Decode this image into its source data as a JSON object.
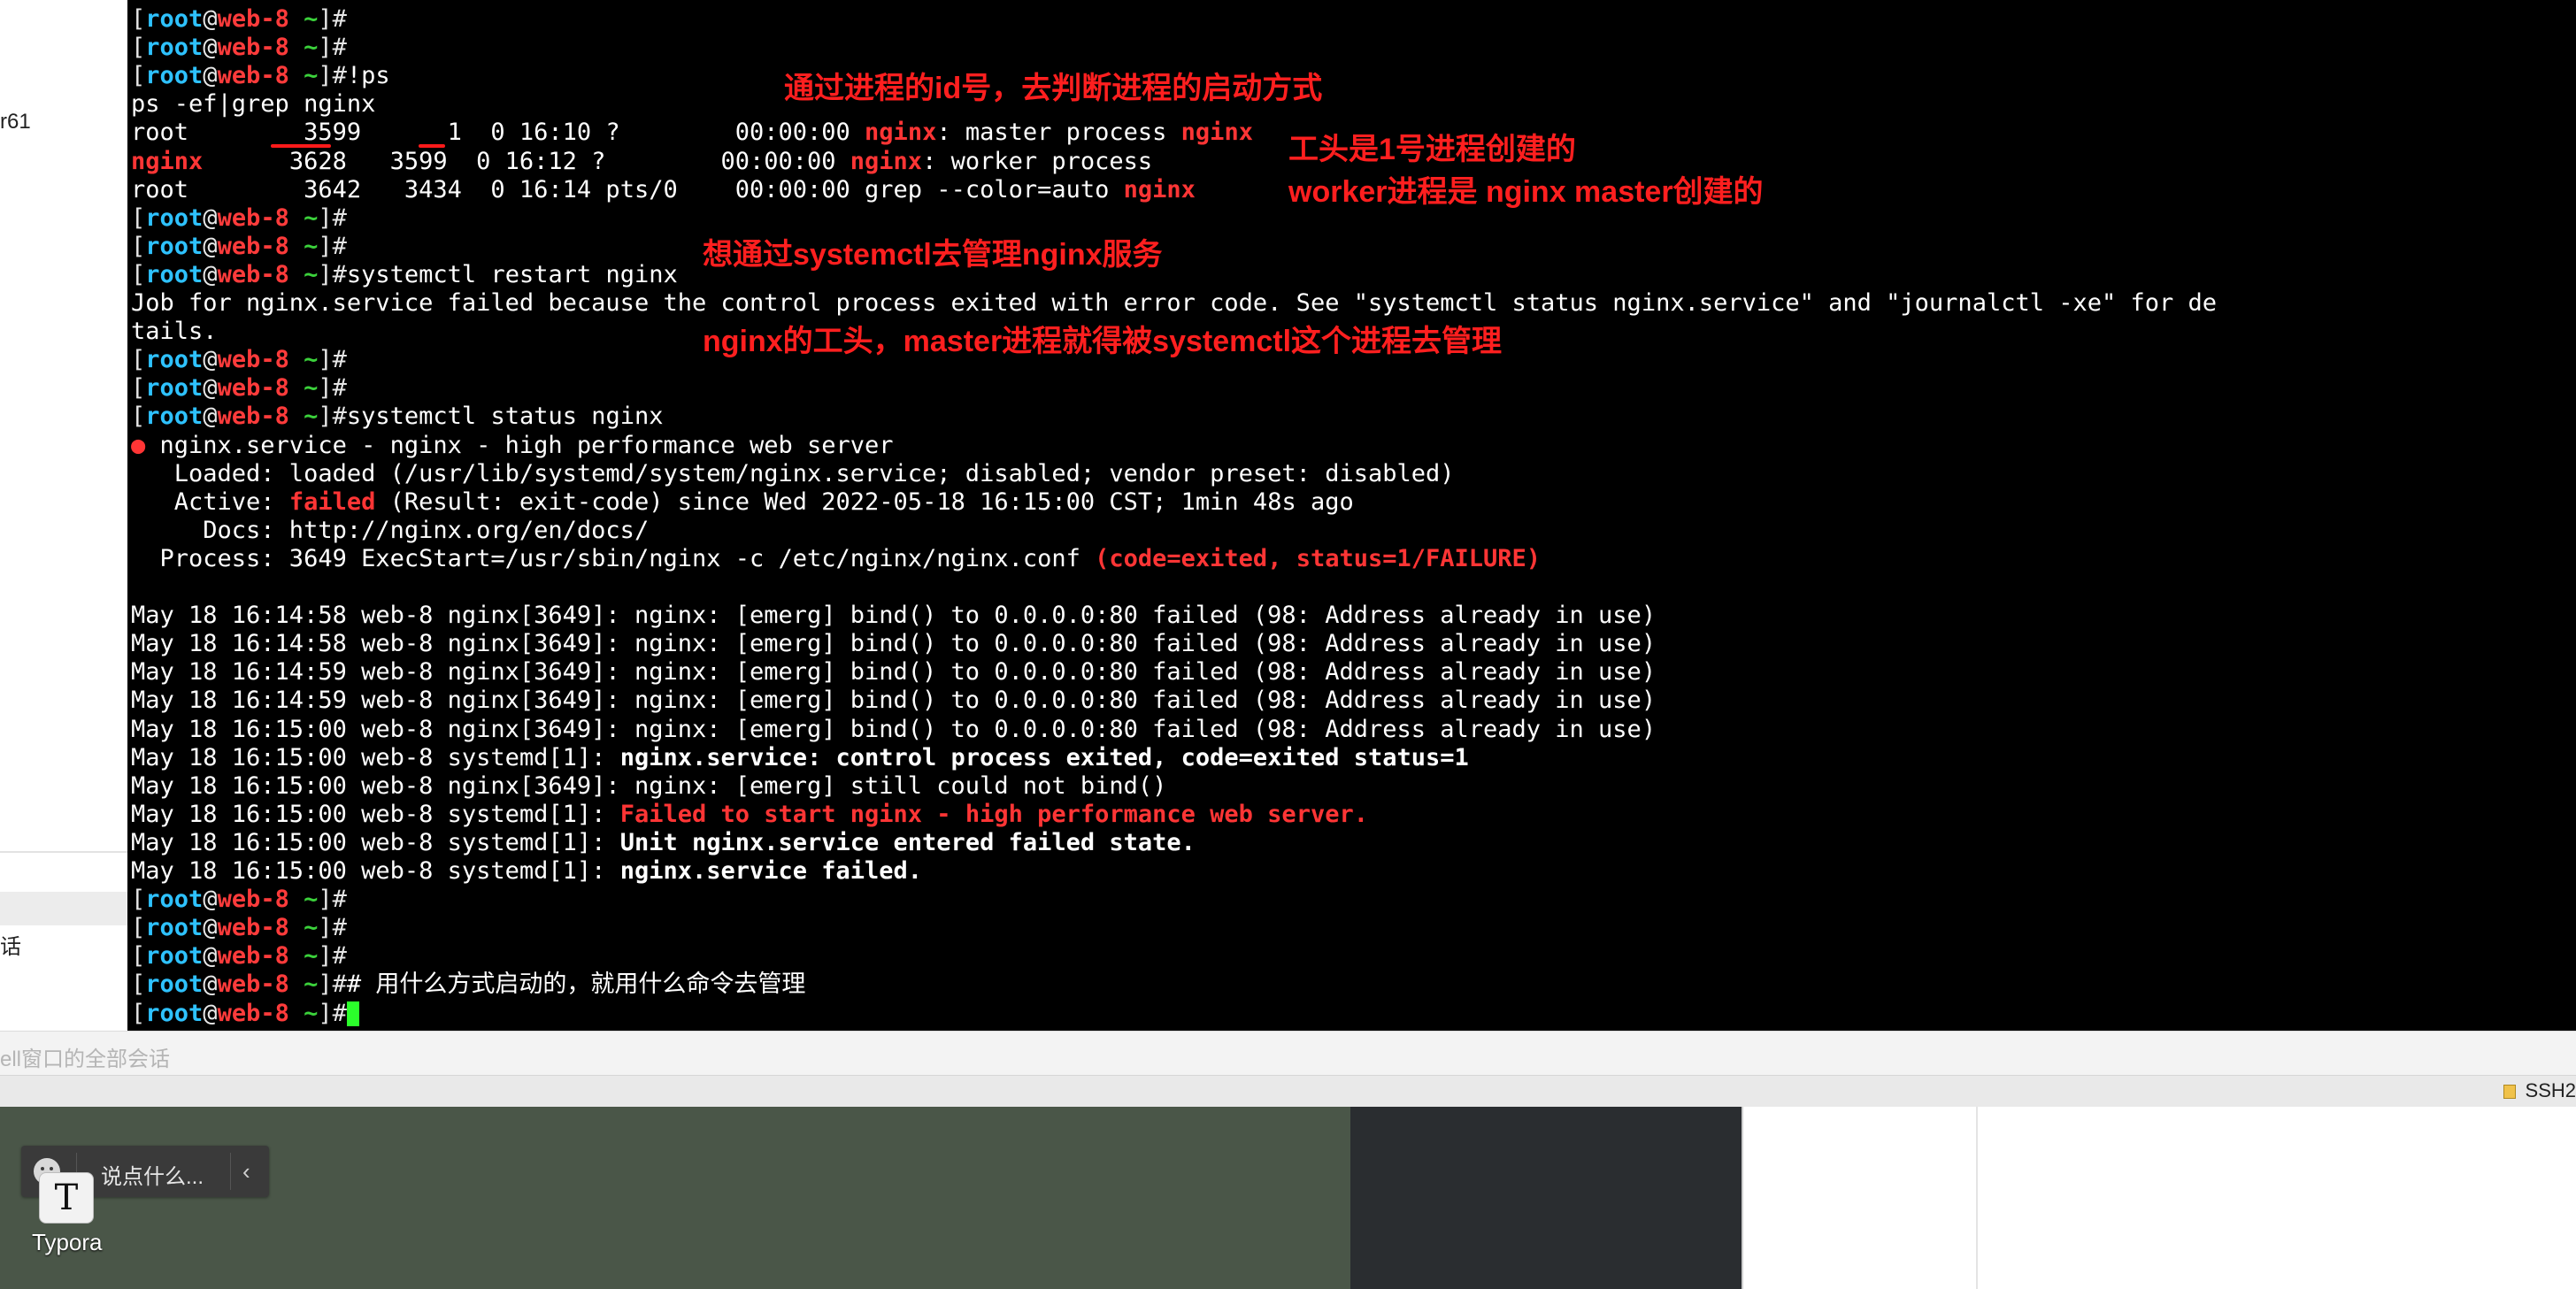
{
  "prompt": {
    "open": "[",
    "user": "root",
    "at": "@",
    "host": "web-8",
    "sep": " ",
    "tilde": "~",
    "close": "]#"
  },
  "left_panel": {
    "item_r61": "r61",
    "item_hua": "话"
  },
  "terminal": {
    "cmd_history": "!ps",
    "ps_cmd": "ps -ef|grep nginx",
    "ps_rows": [
      {
        "user": "root",
        "cols": "        3599      1  0 16:10 ?        00:00:00 ",
        "nginx": "nginx",
        "mid": ": master process ",
        "tail": "nginx"
      },
      {
        "user": "nginx",
        "cols": "      3628   3599  0 16:12 ?        00:00:00 ",
        "nginx": "nginx",
        "mid": ": worker process",
        "tail": ""
      },
      {
        "user": "root",
        "cols": "        3642   3434  0 16:14 pts/0    00:00:00 grep --color=auto ",
        "nginx": "",
        "mid": "",
        "tail": "nginx"
      }
    ],
    "restart_cmd": "systemctl restart nginx",
    "job_failed_1": "Job for nginx.service failed because the control process exited with error code. See \"systemctl status nginx.service\" and \"journalctl -xe\" for de",
    "job_failed_2": "tails.",
    "status_cmd": "systemctl status nginx",
    "status_dot": "●",
    "status_title": " nginx.service - nginx - high performance web server",
    "loaded": "   Loaded: loaded (/usr/lib/systemd/system/nginx.service; disabled; vendor preset: disabled)",
    "active_label": "   Active: ",
    "active_failed": "failed",
    "active_rest": " (Result: exit-code) since Wed 2022-05-18 16:15:00 CST; 1min 48s ago",
    "docs": "     Docs: http://nginx.org/en/docs/",
    "process_text": "  Process: 3649 ExecStart=/usr/sbin/nginx -c /etc/nginx/nginx.conf ",
    "process_code": "(code=exited, status=1/FAILURE)",
    "logs": [
      {
        "plain": "May 18 16:14:58 web-8 nginx[3649]: nginx: [emerg] bind() to 0.0.0.0:80 failed (98: Address already in use)",
        "hl": "",
        "style": ""
      },
      {
        "plain": "May 18 16:14:58 web-8 nginx[3649]: nginx: [emerg] bind() to 0.0.0.0:80 failed (98: Address already in use)",
        "hl": "",
        "style": ""
      },
      {
        "plain": "May 18 16:14:59 web-8 nginx[3649]: nginx: [emerg] bind() to 0.0.0.0:80 failed (98: Address already in use)",
        "hl": "",
        "style": ""
      },
      {
        "plain": "May 18 16:14:59 web-8 nginx[3649]: nginx: [emerg] bind() to 0.0.0.0:80 failed (98: Address already in use)",
        "hl": "",
        "style": ""
      },
      {
        "plain": "May 18 16:15:00 web-8 nginx[3649]: nginx: [emerg] bind() to 0.0.0.0:80 failed (98: Address already in use)",
        "hl": "",
        "style": ""
      },
      {
        "plain": "May 18 16:15:00 web-8 systemd[1]: ",
        "hl": "nginx.service: control process exited, code=exited status=1",
        "style": "bold"
      },
      {
        "plain": "May 18 16:15:00 web-8 nginx[3649]: nginx: [emerg] still could not bind()",
        "hl": "",
        "style": ""
      },
      {
        "plain": "May 18 16:15:00 web-8 systemd[1]: ",
        "hl": "Failed to start nginx - high performance web server.",
        "style": "red"
      },
      {
        "plain": "May 18 16:15:00 web-8 systemd[1]: ",
        "hl": "Unit nginx.service entered failed state.",
        "style": "bold"
      },
      {
        "plain": "May 18 16:15:00 web-8 systemd[1]: ",
        "hl": "nginx.service failed.",
        "style": "bold"
      }
    ],
    "comment_cmd": "# 用什么方式启动的，就用什么命令去管理"
  },
  "annotations": {
    "a1": "通过进程的id号，去判断进程的启动方式",
    "a2": "工头是1号进程创建的",
    "a3": "worker进程是 nginx master创建的",
    "a4": "想通过systemctl去管理nginx服务",
    "a5": "nginx的工头，master进程就得被systemctl这个进程去管理"
  },
  "hint_bar": {
    "text": "ell窗口的全部会话"
  },
  "status_bar": {
    "ssh": "SSH2"
  },
  "desktop": {
    "chat_placeholder": "说点什么...",
    "chat_chevron": "‹",
    "typora_letter": "T",
    "typora_label": "Typora"
  },
  "colors": {
    "terminal_bg": "#000000",
    "prompt_user": "#2ec2ff",
    "prompt_host": "#ff3b3b",
    "prompt_tilde": "#3bd13b",
    "annotation": "#ff1f1f",
    "cursor": "#2bff2b"
  }
}
